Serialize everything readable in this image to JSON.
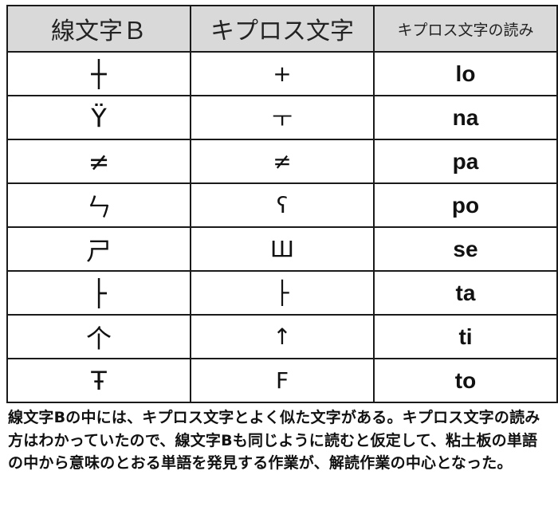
{
  "table": {
    "headers": {
      "linear_b": "線文字Ｂ",
      "cypriot": "キプロス文字",
      "reading": "キプロス文字の読み"
    },
    "rows": [
      {
        "linear_b": "┼",
        "cypriot": "+",
        "reading": "lo"
      },
      {
        "linear_b": "Ÿ",
        "cypriot": "ㅜ",
        "reading": "na"
      },
      {
        "linear_b": "≠",
        "cypriot": "≠",
        "reading": "pa"
      },
      {
        "linear_b": "ㄣ",
        "cypriot": "ʕ",
        "reading": "po"
      },
      {
        "linear_b": "ㄕ",
        "cypriot": "Ш",
        "reading": "se"
      },
      {
        "linear_b": "├",
        "cypriot": "├",
        "reading": "ta"
      },
      {
        "linear_b": "个",
        "cypriot": "↑",
        "reading": "ti"
      },
      {
        "linear_b": "Ŧ",
        "cypriot": "F",
        "reading": "to"
      }
    ]
  },
  "caption": "線文字Bの中には、キプロス文字とよく似た文字がある。キプロス文字の読み方はわかっていたので、線文字Bも同じように読むと仮定して、粘土板の単語の中から意味のとおる単語を発見する作業が、解読作業の中心となった。"
}
